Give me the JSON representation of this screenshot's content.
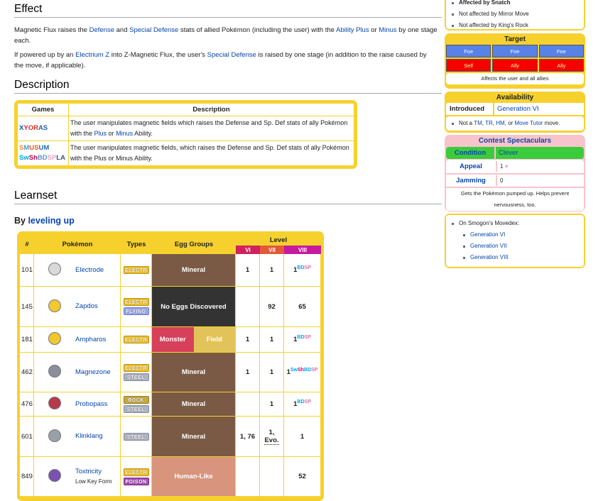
{
  "effect": {
    "heading": "Effect",
    "p1": {
      "a": "Magnetic Flux raises the ",
      "l1": "Defense",
      "b": " and ",
      "l2": "Special Defense",
      "c": " stats of allied Pokémon (including the user) with the ",
      "l3": "Ability Plus",
      "d": " or ",
      "l4": "Minus",
      "e": " by one stage each."
    },
    "p2": {
      "a": "If powered up by an ",
      "l1": "Electrium Z",
      "b": " into Z-Magnetic Flux, the user's ",
      "l2": "Special Defense",
      "c": " is raised by one stage (in addition to the raise caused by the move, if applicable)."
    }
  },
  "description": {
    "heading": "Description",
    "col_games": "Games",
    "col_description": "Description",
    "rows": [
      {
        "games": [
          [
            "X",
            "#025da6"
          ],
          [
            "Y",
            "#ea1a3e"
          ],
          [
            "OR",
            "#cf3025"
          ],
          [
            "AS",
            "#26649c"
          ]
        ],
        "a": "The user manipulates magnetic fields which raises the Defense and Sp. Def stats of ally Pokémon with the ",
        "l1": "Plus",
        "b": " or ",
        "l2": "Minus",
        "c": " Ability."
      },
      {
        "games1": [
          [
            "S",
            "#f1912b"
          ],
          [
            "M",
            "#5599ca"
          ],
          [
            "US",
            "#e95b2b"
          ],
          [
            "UM",
            "#226db5"
          ]
        ],
        "games2": [
          [
            "Sw",
            "#00a1e9"
          ],
          [
            "Sh",
            "#bf004f"
          ],
          [
            "BD",
            "#5e8fcd"
          ],
          [
            "SP",
            "#e8a4c3"
          ],
          [
            "LA",
            "#36597b"
          ]
        ],
        "text": "The user manipulates magnetic fields, which raises the Defense and Sp. Def stats of ally Pokémon with the Plus or Minus Ability."
      }
    ]
  },
  "learnset": {
    "heading": "Learnset",
    "sub_prefix": "By ",
    "sub_link": "leveling up",
    "headers": {
      "num": "#",
      "pokemon": "Pokémon",
      "types": "Types",
      "egg": "Egg Groups",
      "level": "Level",
      "vi": "VI",
      "vii": "VII",
      "viii": "VIII"
    },
    "rows": [
      {
        "num": "101",
        "name": "Electrode",
        "types": [
          "ELECTR"
        ],
        "egg": [
          "Mineral"
        ],
        "vi": "1",
        "vii": "1",
        "viii": "1",
        "sup": "BDSP"
      },
      {
        "num": "145",
        "name": "Zapdos",
        "types": [
          "ELECTR",
          "FLYING"
        ],
        "egg": [
          "No Eggs Discovered"
        ],
        "vi": "",
        "vii": "92",
        "viii": "65",
        "sup": ""
      },
      {
        "num": "181",
        "name": "Ampharos",
        "types": [
          "ELECTR"
        ],
        "egg": [
          "Monster",
          "Field"
        ],
        "vi": "1",
        "vii": "1",
        "viii": "1",
        "sup": "BDSP"
      },
      {
        "num": "462",
        "name": "Magnezone",
        "types": [
          "ELECTR",
          "STEEL"
        ],
        "egg": [
          "Mineral"
        ],
        "vi": "1",
        "vii": "1",
        "viii": "1",
        "sup": "SwShBDSP"
      },
      {
        "num": "476",
        "name": "Probopass",
        "types": [
          "ROCK",
          "STEEL"
        ],
        "egg": [
          "Mineral"
        ],
        "vi": "",
        "vii": "1",
        "viii": "1",
        "sup": "BDSP"
      },
      {
        "num": "601",
        "name": "Klinklang",
        "types": [
          "STEEL"
        ],
        "egg": [
          "Mineral"
        ],
        "vi": "1, 76",
        "vii": "1,",
        "vii2": "Evo.",
        "viii": "1",
        "sup": ""
      },
      {
        "num": "849",
        "name": "Toxtricity",
        "form": "Low Key Form",
        "types": [
          "ELECTR",
          "POISON"
        ],
        "egg": [
          "Human-Like"
        ],
        "vi": "",
        "vii": "",
        "viii": "52",
        "sup": ""
      }
    ]
  },
  "sidebar": {
    "flags": [
      "Affected by Snatch",
      "Not affected by Mirror Move",
      "Not affected by King's Rock"
    ],
    "target": {
      "title": "Target",
      "row1": [
        "Foe",
        "Foe",
        "Foe"
      ],
      "row2": [
        "Self",
        "Ally",
        "Ally"
      ],
      "note": "Affects the user and all allies"
    },
    "availability": {
      "title": "Availability",
      "introduced_label": "Introduced",
      "introduced_value": "Generation VI",
      "note_a": "Not a ",
      "tm": "TM",
      "c1": ", ",
      "tr": "TR",
      "c2": ", ",
      "hm": "HM",
      "c3": ", or ",
      "tutor": "Move Tutor",
      "note_b": " move."
    },
    "contest": {
      "title": "Contest Spectaculars",
      "condition_label": "Condition",
      "condition_value": "Clever",
      "appeal_label": "Appeal",
      "appeal_value": "1",
      "jamming_label": "Jamming",
      "jamming_value": "0",
      "desc": "Gets the Pokémon pumped up. Helps prevent nervousness, too."
    },
    "smogon": {
      "title": "On Smogon's Movedex:",
      "links": [
        "Generation VI",
        "Generation VII",
        "Generation VIII"
      ]
    }
  },
  "colors": {
    "accent": "#f6d12e",
    "link": "#0645ad",
    "mineral": "#7a5a45",
    "no_eggs": "#333333",
    "monster": "#d6405a",
    "field": "#e2c35a",
    "human_like": "#d8947c",
    "condition": "#3ccb3c"
  }
}
